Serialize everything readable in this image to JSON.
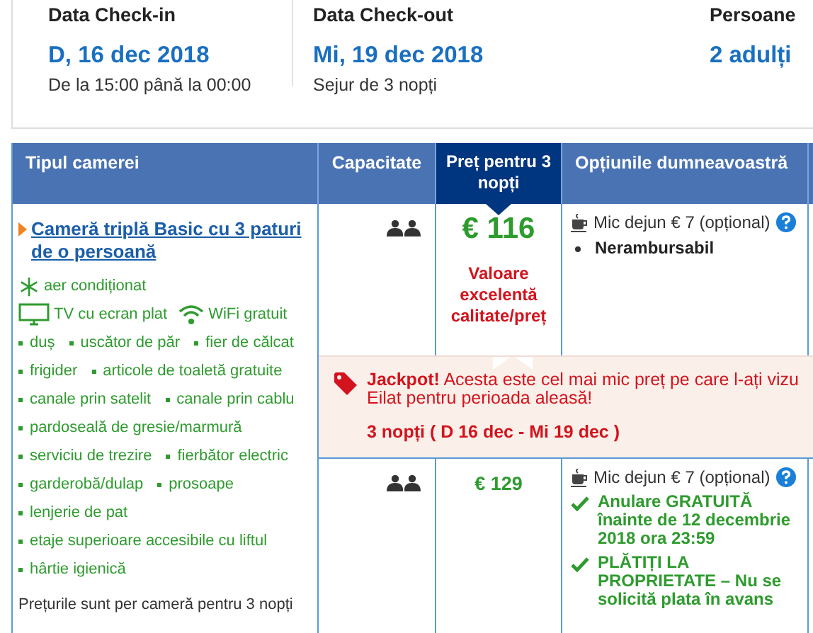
{
  "booking_summary": [
    {
      "label": "Data Check-in",
      "value": "D, 16 dec 2018",
      "note": "De la 15:00 până la 00:00"
    },
    {
      "label": "Data Check-out",
      "value": "Mi, 19 dec 2018",
      "note": "Sejur de 3 nopți"
    },
    {
      "label": "Persoane",
      "value": "2 adulți"
    }
  ],
  "table": {
    "columns": [
      {
        "label": "Tipul camerei",
        "selected": false
      },
      {
        "label": "Capacitate",
        "selected": false
      },
      {
        "label": "Preț pentru 3 nopți",
        "selected": true
      },
      {
        "label": "Opțiunile dumneavoastră",
        "selected": false
      }
    ],
    "room": {
      "name": "Cameră triplă Basic cu 3 paturi de o persoană",
      "amenities": [
        {
          "kind": "aircon",
          "label": "aer condiționat"
        },
        {
          "kind": "tv",
          "label": "TV cu ecran plat"
        },
        {
          "kind": "wifi",
          "label": "WiFi gratuit"
        }
      ],
      "facility_rows": [
        [
          "duș",
          "uscător de păr",
          "fier de călcat"
        ],
        [
          "frigider",
          "articole de toaletă gratuite"
        ],
        [
          "canale prin satelit",
          "canale prin cablu"
        ],
        [
          "pardoseală de gresie/marmură"
        ],
        [
          "serviciu de trezire",
          "fierbător electric"
        ],
        [
          "garderobă/dulap",
          "prosoape"
        ],
        [
          "lenjerie de pat"
        ],
        [
          "etaje superioare accesibile cu liftul"
        ],
        [
          "hârtie igienică"
        ]
      ],
      "note": "Prețurile sunt per cameră pentru 3 nopți"
    },
    "offers": [
      {
        "featured": true,
        "price": "€ 116",
        "badge": "Valoare excelentă calitate/preț",
        "breakfast": "Mic dejun € 7 (opțional)",
        "help": true,
        "conditions": [
          {
            "kind": "bullet",
            "text": "Nerambursabil"
          }
        ]
      },
      {
        "featured": false,
        "price": "€ 129",
        "breakfast": "Mic dejun € 7 (opțional)",
        "help": true,
        "conditions": [
          {
            "kind": "check",
            "text": "Anulare GRATUITĂ înainte de 12 decembrie 2018 ora 23:59"
          },
          {
            "kind": "check",
            "text": "PLĂTIȚI LA PROPRIETATE – Nu se solicită plata în avans"
          }
        ]
      }
    ],
    "jackpot": {
      "message_lines": [
        "**Jackpot!** Acesta este cel mai mic preț pe care l-ați vizu",
        "Eilat pentru perioada aleasă!"
      ],
      "dates": "3 nopți ( D 16 dec - Mi 19 dec )"
    }
  }
}
